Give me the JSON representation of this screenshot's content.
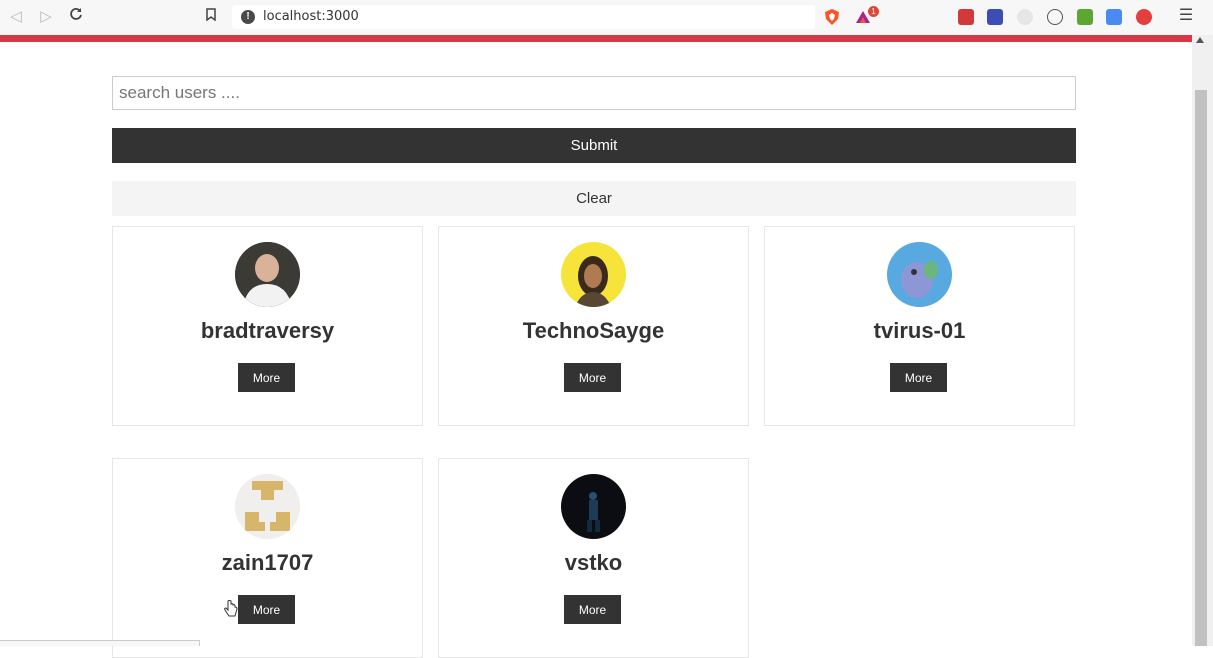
{
  "browser": {
    "url": "localhost:3000",
    "notification_count": "1"
  },
  "search": {
    "placeholder": "search users ....",
    "value": ""
  },
  "buttons": {
    "submit_label": "Submit",
    "clear_label": "Clear"
  },
  "users": [
    {
      "login": "bradtraversy",
      "more_label": "More"
    },
    {
      "login": "TechnoSayge",
      "more_label": "More"
    },
    {
      "login": "tvirus-01",
      "more_label": "More"
    },
    {
      "login": "zain1707",
      "more_label": "More"
    },
    {
      "login": "vstko",
      "more_label": "More"
    }
  ],
  "colors": {
    "accent_line": "#dc3545",
    "dark_button": "#333333",
    "light_button": "#f4f4f4"
  }
}
